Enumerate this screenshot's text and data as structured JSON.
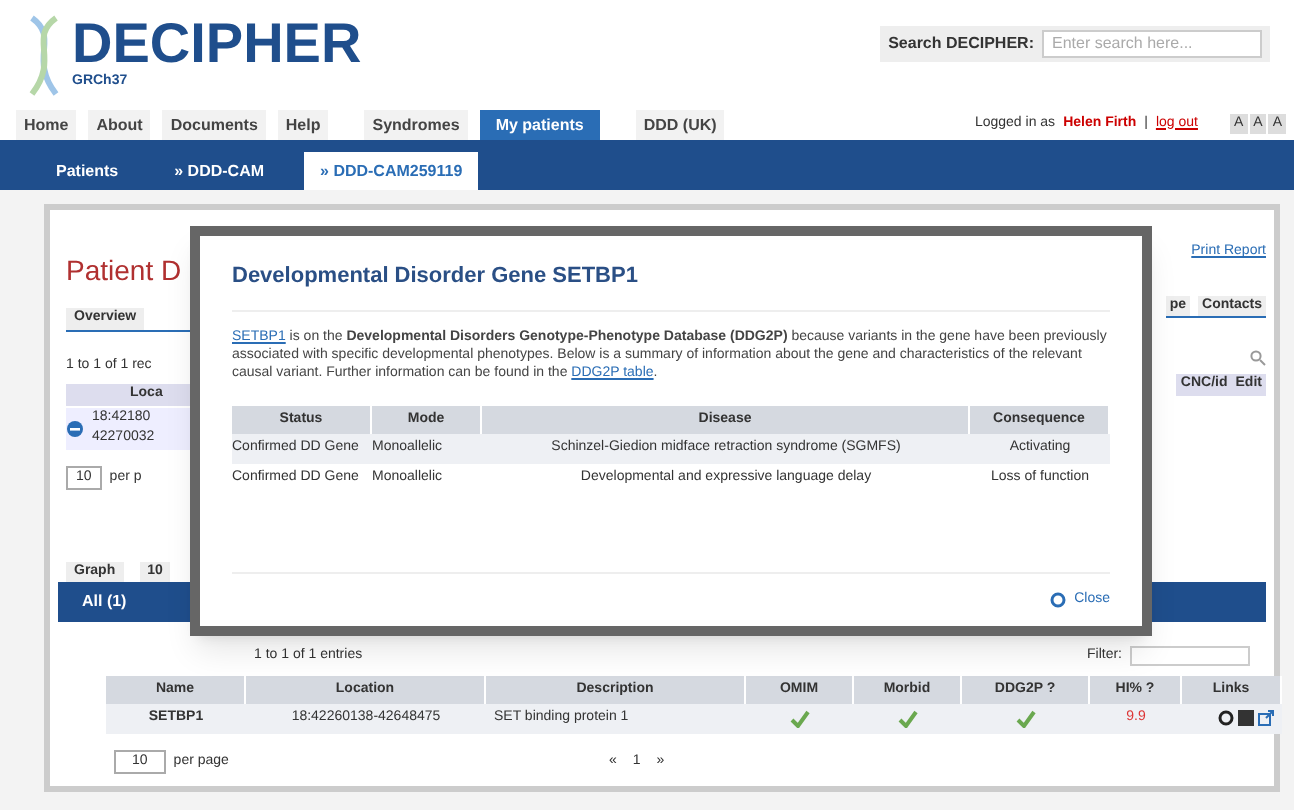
{
  "header": {
    "logo": "DECIPHER",
    "assembly": "GRCh37",
    "search_label": "Search DECIPHER:",
    "search_placeholder": "Enter search here..."
  },
  "nav": {
    "items": [
      {
        "label": "Home",
        "selected": false
      },
      {
        "label": "About",
        "selected": false
      },
      {
        "label": "Documents",
        "selected": false
      },
      {
        "label": "Help",
        "selected": false
      },
      {
        "label": "Syndromes",
        "selected": false
      },
      {
        "label": "My patients",
        "selected": true
      },
      {
        "label": "DDD (UK)",
        "selected": false
      }
    ],
    "login_prefix": "Logged in as",
    "user": "Helen Firth",
    "separator": "|",
    "logout": "log out",
    "font_sizes": [
      "A",
      "A",
      "A"
    ]
  },
  "breadcrumbs": [
    {
      "label": "Patients",
      "selected": false
    },
    {
      "label": "» DDD-CAM",
      "selected": false
    },
    {
      "label": "» DDD-CAM259119",
      "selected": true
    }
  ],
  "background": {
    "title": "Patient D",
    "tab": "Overview",
    "records": "1 to 1 of 1 rec",
    "column": "Loca",
    "location_lines": [
      "18:42180",
      "42270032"
    ],
    "per_page_value": "10",
    "per_page": "per p",
    "lower_tabs": [
      "Graph",
      "10"
    ],
    "all_tab": "All (1)",
    "print_report": "Print Report",
    "right_tabs": [
      "pe",
      "Contacts"
    ],
    "right_columns": [
      "CNC/id",
      "Edit"
    ]
  },
  "genes": {
    "info": "1 to 1 of 1 entries",
    "filter_label": "Filter:",
    "columns": [
      "Name",
      "Location",
      "Description",
      "OMIM",
      "Morbid",
      "DDG2P ?",
      "HI% ?",
      "Links"
    ],
    "rows": [
      {
        "name": "SETBP1",
        "location": "18:42260138-42648475",
        "description": "SET binding protein 1",
        "omim": true,
        "morbid": true,
        "ddg2p": true,
        "hi": "9.9"
      }
    ],
    "per_page_value": "10",
    "per_page": "per page",
    "pagination": [
      "«",
      "1",
      "»"
    ]
  },
  "modal": {
    "title": "Developmental Disorder Gene SETBP1",
    "paragraph": [
      {
        "kind": "link",
        "text": "SETBP1"
      },
      {
        "kind": "text",
        "text": " is on the **Developmental Disorders Genotype-Phenotype Database (DDG2P)** because variants in the gene have been previously associated with specific developmental phenotypes. Below is a summary of information about the gene and characteristics of the relevant causal variant. Further information can be found in the "
      },
      {
        "kind": "link",
        "text": "DDG2P table"
      },
      {
        "kind": "text",
        "text": "."
      }
    ],
    "columns": [
      "Status",
      "Mode",
      "Disease",
      "Consequence"
    ],
    "rows": [
      [
        "Confirmed DD Gene",
        "Monoallelic",
        "Schinzel-Giedion midface retraction syndrome (SGMFS)",
        "Activating"
      ],
      [
        "Confirmed DD Gene",
        "Monoallelic",
        "Developmental and expressive language delay",
        "Loss of function"
      ]
    ],
    "close": "Close"
  }
}
